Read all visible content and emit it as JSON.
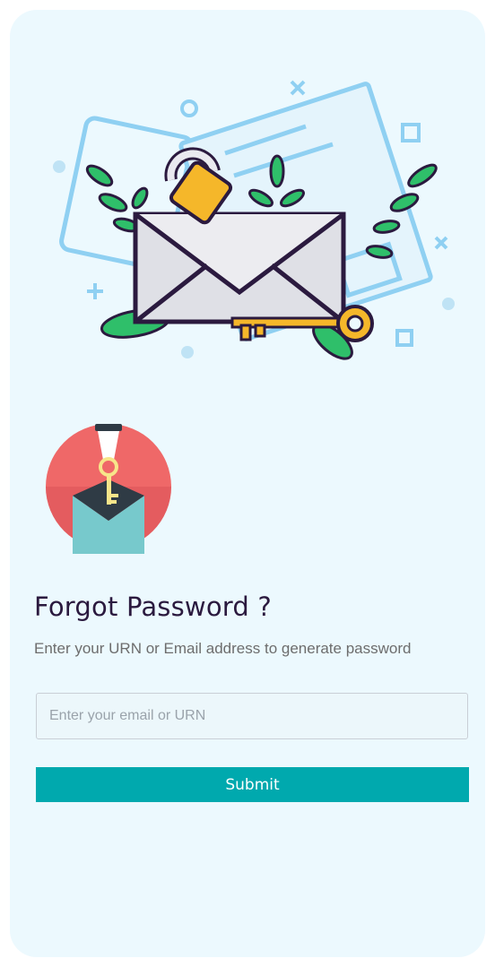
{
  "page": {
    "title": "Forgot Password ?",
    "subtitle": "Enter your URN or Email address to generate password"
  },
  "form": {
    "email_placeholder": "Enter your email or URN",
    "email_value": "",
    "submit_label": "Submit"
  },
  "illustrations": {
    "hero": "envelope-lock-key-illustration",
    "badge": "hand-key-envelope-icon"
  },
  "colors": {
    "background": "#ecf9fe",
    "title": "#2b1a3f",
    "subtitle": "#6d6d6d",
    "button": "#00a9ae",
    "button_text": "#ffffff"
  }
}
